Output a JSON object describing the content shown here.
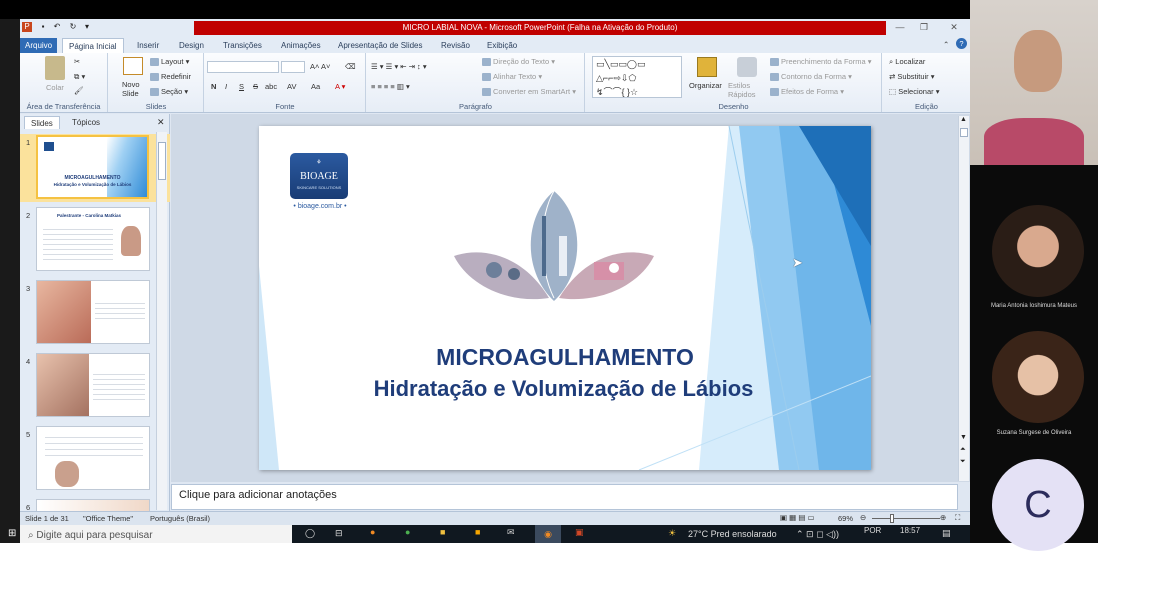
{
  "window": {
    "title": "MICRO LABIAL NOVA  -  Microsoft PowerPoint (Falha na Ativação do Produto)"
  },
  "tabs": {
    "file": "Arquivo",
    "items": [
      "Página Inicial",
      "Inserir",
      "Design",
      "Transições",
      "Animações",
      "Apresentação de Slides",
      "Revisão",
      "Exibição"
    ]
  },
  "ribbon": {
    "clipboard": {
      "paste": "Colar",
      "group": "Área de Transferência"
    },
    "slides": {
      "new_slide": "Novo Slide",
      "layout": "Layout",
      "reset": "Redefinir",
      "section": "Seção",
      "group": "Slides"
    },
    "font": {
      "group": "Fonte",
      "bold": "N",
      "italic": "I",
      "underline": "S",
      "strike": "S",
      "shadow": "abc",
      "spacing": "AV",
      "case": "Aa"
    },
    "paragraph": {
      "group": "Parágrafo",
      "text_direction": "Direção do Texto",
      "align_text": "Alinhar Texto",
      "smartart": "Converter em SmartArt"
    },
    "drawing": {
      "group": "Desenho",
      "arrange": "Organizar",
      "quick_styles": "Estilos Rápidos",
      "fill": "Preenchimento da Forma",
      "outline": "Contorno da Forma",
      "effects": "Efeitos de Forma"
    },
    "editing": {
      "group": "Edição",
      "find": "Localizar",
      "replace": "Substituir",
      "select": "Selecionar"
    }
  },
  "left_panel": {
    "tab_slides": "Slides",
    "tab_outline": "Tópicos",
    "slide_numbers": [
      "1",
      "2",
      "3",
      "4",
      "5",
      "6"
    ],
    "thumb1_title": "MICROAGULHAMENTO",
    "thumb1_sub": "Hidratação e Volumização de Lábios",
    "thumb2_title": "Palestrante - Carolina Matkias"
  },
  "slide": {
    "brand": "BIOAGE",
    "brand_tagline": "SKINCARE SOLUTIONS",
    "site": "• bioage.com.br •",
    "title": "MICROAGULHAMENTO",
    "subtitle": "Hidratação e Volumização de Lábios"
  },
  "notes": {
    "placeholder": "Clique para adicionar anotações"
  },
  "statusbar": {
    "slide_info": "Slide 1 de 31",
    "theme": "\"Office Theme\"",
    "language": "Português (Brasil)",
    "zoom": "69%"
  },
  "taskbar": {
    "search": "Digite aqui para pesquisar",
    "weather": "27°C  Pred ensolarado",
    "lang": "POR",
    "time": "18:57"
  },
  "participants": [
    {
      "name": "Maria Antonia Ioshimura Mateus"
    },
    {
      "name": "Suzana Surgese de Oliveira"
    },
    {
      "name": "C"
    }
  ],
  "colors": {
    "title_blue": "#1f3d7a",
    "slide_accent": "#2e8ad6",
    "titlebar_red": "#c00000"
  }
}
